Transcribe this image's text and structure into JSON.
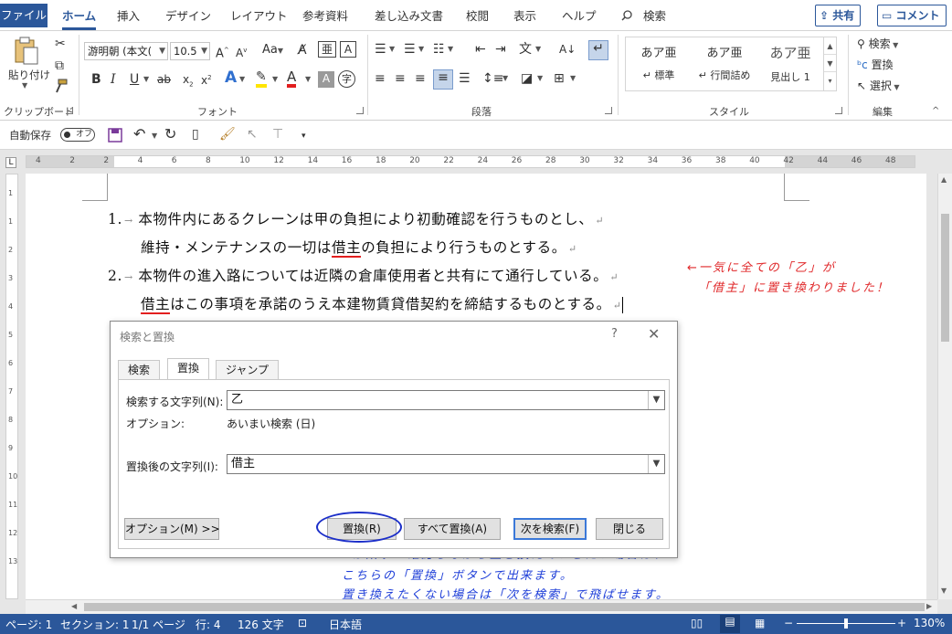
{
  "tabs": {
    "file": "ファイル",
    "home": "ホーム",
    "insert": "挿入",
    "design": "デザイン",
    "layout": "レイアウト",
    "references": "参考資料",
    "mailings": "差し込み文書",
    "review": "校閲",
    "view": "表示",
    "help": "ヘルプ",
    "search": "検索"
  },
  "header_buttons": {
    "share": "共有",
    "comment": "コメント"
  },
  "ribbon": {
    "clipboard": {
      "paste": "貼り付け",
      "label": "クリップボード"
    },
    "font": {
      "name": "游明朝 (本文(",
      "size": "10.5",
      "case": "Aa",
      "label": "フォント"
    },
    "paragraph": {
      "label": "段落"
    },
    "styles": {
      "items": [
        {
          "preview": "あア亜",
          "name": "↵ 標準"
        },
        {
          "preview": "あア亜",
          "name": "↵ 行間詰め"
        },
        {
          "preview": "あア亜",
          "name": "見出し 1"
        }
      ],
      "label": "スタイル"
    },
    "editing": {
      "find": "検索",
      "replace": "置換",
      "select": "選択",
      "label": "編集"
    }
  },
  "qat": {
    "autosave": "自動保存",
    "toggle": "オフ"
  },
  "ruler": {
    "ticks": [
      "4",
      "2",
      "2",
      "4",
      "6",
      "8",
      "10",
      "12",
      "14",
      "16",
      "18",
      "20",
      "22",
      "24",
      "26",
      "28",
      "30",
      "32",
      "34",
      "36",
      "38",
      "40",
      "42",
      "44",
      "46",
      "48"
    ],
    "vticks": [
      "1",
      "1",
      "2",
      "3",
      "4",
      "5",
      "6",
      "7",
      "8",
      "9",
      "10",
      "11",
      "12",
      "13"
    ]
  },
  "document": {
    "line1": {
      "num": "1.",
      "text": "本物件内にあるクレーンは甲の負担により初動確認を行うものとし、"
    },
    "line2": {
      "a": "維持・メンテナンスの一切は",
      "b": "借主",
      "c": "の負担により行うものとする。"
    },
    "line3": {
      "num": "2.",
      "text": "本物件の進入路については近隣の倉庫使用者と共有にて通行している。"
    },
    "line4": {
      "b": "借主",
      "c": "はこの事項を承諾のうえ本建物賃貸借契約を締結するものとする。"
    },
    "tab_arrow": "→",
    "para_mark": "↵"
  },
  "annotations": {
    "red_line1": "←一気に全ての「乙」が",
    "red_line2": "「借主」に置き換わりました！",
    "blue_line1": "↑一か所ずつ確認しながら置き換えていきたい場合は、",
    "blue_line2": "こちらの「置換」ボタンで出来ます。",
    "blue_line3": "置き換えたくない場合は「次を検索」で飛ばせます。"
  },
  "dialog": {
    "title": "検索と置換",
    "help": "?",
    "close": "✕",
    "tabs": [
      "検索",
      "置換",
      "ジャンプ"
    ],
    "find_label": "検索する文字列(N):",
    "find_value": "乙",
    "option_label": "オプション:",
    "option_value": "あいまい検索 (日)",
    "replace_label": "置換後の文字列(I):",
    "replace_value": "借主",
    "buttons": {
      "options": "オプション(M) >>",
      "replace": "置換(R)",
      "replace_all": "すべて置換(A)",
      "find_next": "次を検索(F)",
      "close": "閉じる"
    }
  },
  "status": {
    "page": "ページ: 1",
    "section": "セクション: 1",
    "page_of": "1/1 ページ",
    "row": "行: 4",
    "chars": "126 文字",
    "language": "日本語",
    "zoom": "130%"
  }
}
